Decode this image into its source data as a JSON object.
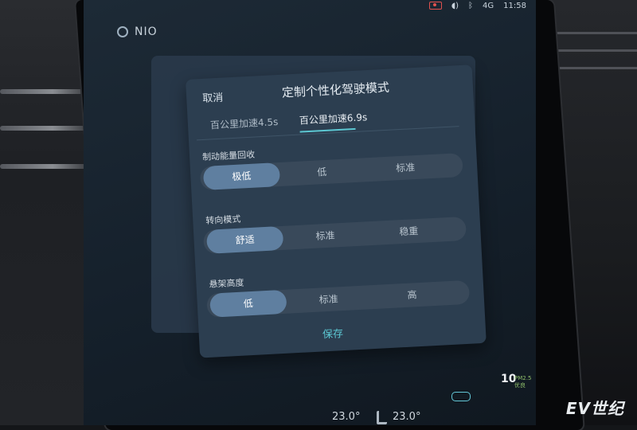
{
  "status_bar": {
    "recording_icon": "dashcam-recording-icon",
    "sound_icon": "sound-icon",
    "bluetooth_icon": "bluetooth-icon",
    "network": "4G",
    "time": "11:58"
  },
  "brand": {
    "name": "NIO"
  },
  "dialog": {
    "cancel_label": "取消",
    "title": "定制个性化驾驶模式",
    "tabs": [
      {
        "label": "百公里加速4.5s",
        "active": false
      },
      {
        "label": "百公里加速6.9s",
        "active": true
      }
    ],
    "groups": [
      {
        "label": "制动能量回收",
        "options": [
          "极低",
          "低",
          "标准"
        ],
        "selected": "极低"
      },
      {
        "label": "转向模式",
        "options": [
          "舒适",
          "标准",
          "稳重"
        ],
        "selected": "舒适"
      },
      {
        "label": "悬架高度",
        "options": [
          "低",
          "标准",
          "高"
        ],
        "selected": "低"
      }
    ],
    "save_label": "保存"
  },
  "bottom_bar": {
    "temp_left": "23.0°",
    "temp_right": "23.0°",
    "pm_value": "10",
    "pm_label": "PM2.5 优良"
  },
  "watermark": "EV世纪",
  "colors": {
    "accent": "#5cc7d2",
    "selected": "#5f7fa0",
    "panel": "#2c3e50"
  }
}
